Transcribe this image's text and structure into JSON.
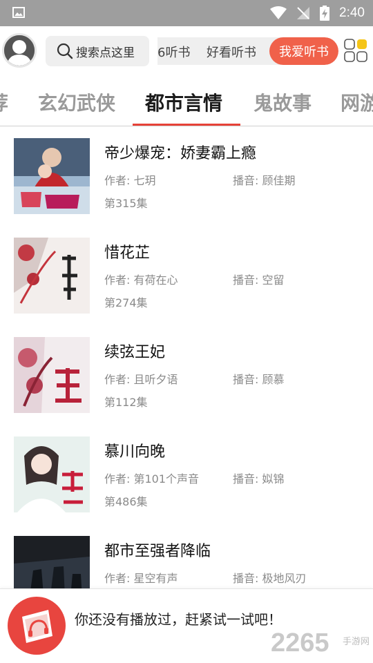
{
  "status_bar": {
    "time": "2:40",
    "icons": [
      "gallery-icon",
      "wifi-icon",
      "no-signal-icon",
      "battery-charging-icon"
    ]
  },
  "header": {
    "avatar_icon": "user-avatar-icon",
    "search_label": "搜索点这里",
    "quick_links": [
      "6听书",
      "好看听书",
      "我爱听书"
    ],
    "grid_icon": "grid-icon"
  },
  "tabs": {
    "items": [
      "荐",
      "玄幻武侠",
      "都市言情",
      "鬼故事",
      "网游"
    ],
    "active": "都市言情"
  },
  "books": [
    {
      "title": "帝少爆宠：娇妻霸上瘾",
      "author": "作者: 七玥",
      "narrator": "播音: 顾佳期",
      "episodes": "第315集"
    },
    {
      "title": "惜花芷",
      "author": "作者: 有荷在心",
      "narrator": "播音: 空留",
      "episodes": "第274集"
    },
    {
      "title": "续弦王妃",
      "author": "作者: 且听夕语",
      "narrator": "播音: 顾慕",
      "episodes": "第112集"
    },
    {
      "title": "慕川向晚",
      "author": "作者: 第101个声音",
      "narrator": "播音: 姒锦",
      "episodes": "第486集"
    },
    {
      "title": "都市至强者降临",
      "author": "作者: 星空有声",
      "narrator": "播音: 极地风刃",
      "episodes": ""
    }
  ],
  "player": {
    "message": "你还没有播放过，赶紧试一试吧！",
    "logo_icon": "headphone-book-logo-icon"
  },
  "watermark": {
    "text": "2265",
    "subtext": "手游网"
  },
  "colors": {
    "accent": "#f0614a",
    "tab_underline": "#e64238",
    "status_bar": "#9e9e9e"
  }
}
